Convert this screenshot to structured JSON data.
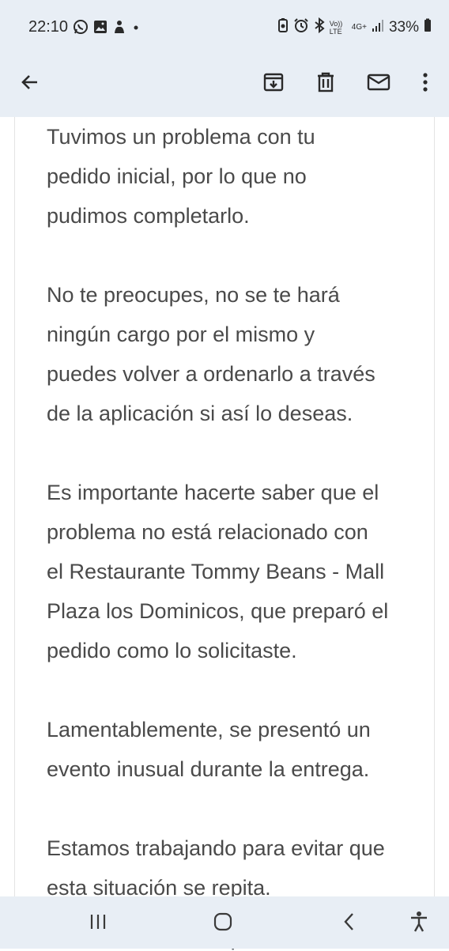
{
  "status_bar": {
    "time": "22:10",
    "left_icons": [
      "whatsapp-icon",
      "gallery-icon",
      "notification-icon",
      "dot-icon"
    ],
    "right_icons": [
      "battery-saver-icon",
      "alarm-icon",
      "bluetooth-icon",
      "volte-icon",
      "network-4g-icon",
      "signal-icon"
    ],
    "volte_text": "Vo)) LTE",
    "network_text": "4G+",
    "battery_percent": "33%"
  },
  "toolbar": {
    "back_icon": "arrow-back-icon",
    "actions": [
      "archive-icon",
      "delete-icon",
      "mark-unread-icon",
      "more-options-icon"
    ]
  },
  "email_body": {
    "paragraphs": [
      [
        "Tuvimos un problema con tu",
        "pedido inicial, por lo que no",
        "pudimos completarlo."
      ],
      [
        "No te preocupes, no se te hará",
        "ningún cargo por el mismo y",
        "puedes volver a ordenarlo a través",
        "de la aplicación si así lo deseas."
      ],
      [
        "Es importante hacerte saber que el",
        "problema no está relacionado con",
        "el Restaurante Tommy Beans - Mall",
        "Plaza los Dominicos, que preparó el",
        "pedido como lo solicitaste."
      ],
      [
        "Lamentablemente, se presentó un",
        "evento inusual durante la entrega."
      ],
      [
        "Estamos trabajando para evitar que",
        "esta situación se repita."
      ]
    ]
  },
  "nav_bar": {
    "buttons": [
      "recent-apps-icon",
      "home-icon",
      "back-nav-icon",
      "accessibility-icon"
    ]
  },
  "colors": {
    "bar_background": "#e8eef5",
    "body_text": "#4a4a4a"
  }
}
